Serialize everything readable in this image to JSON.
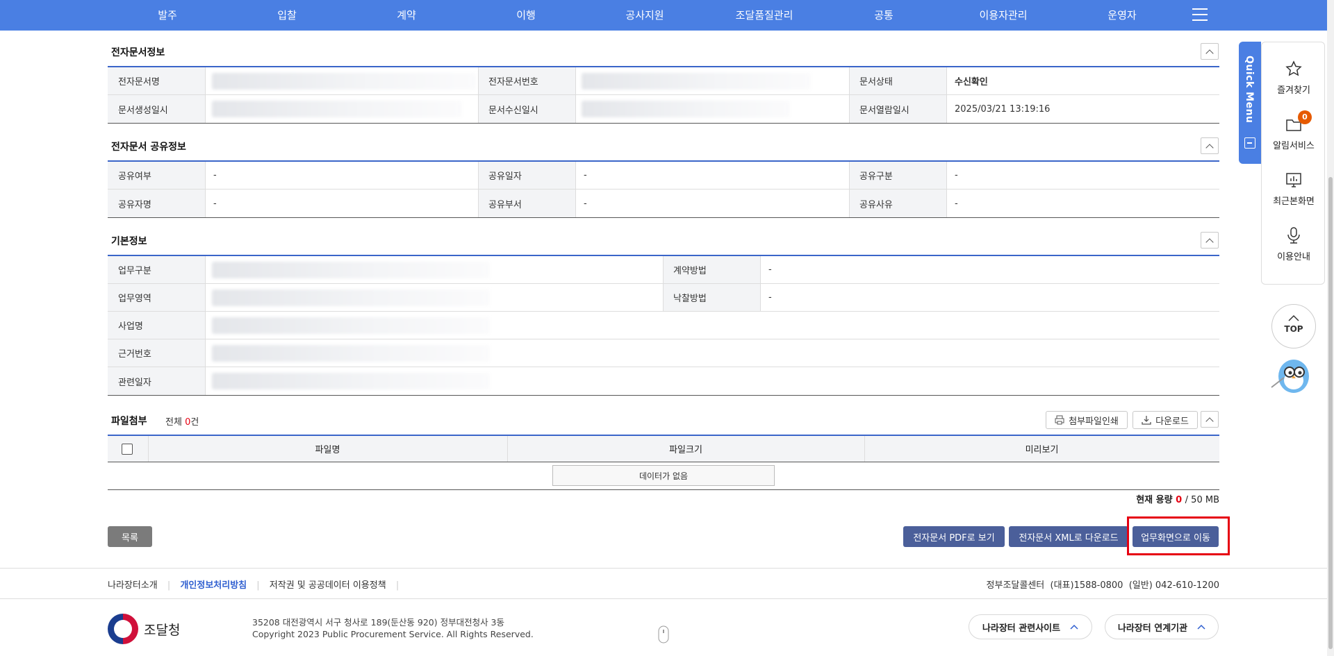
{
  "topnav": {
    "items": [
      "발주",
      "입찰",
      "계약",
      "이행",
      "공사지원",
      "조달품질관리",
      "공통",
      "이용자관리",
      "운영자"
    ]
  },
  "doc_info": {
    "title": "전자문서정보",
    "labels": {
      "name": "전자문서명",
      "number": "전자문서번호",
      "status": "문서상태",
      "created": "문서생성일시",
      "received": "문서수신일시",
      "opened": "문서열람일시"
    },
    "status_value": "수신확인",
    "opened_value": "2025/03/21 13:19:16"
  },
  "share_info": {
    "title": "전자문서 공유정보",
    "labels": {
      "shared": "공유여부",
      "share_date": "공유일자",
      "share_type": "공유구분",
      "sharer": "공유자명",
      "share_dept": "공유부서",
      "share_reason": "공유사유"
    },
    "values": {
      "shared": "-",
      "share_date": "-",
      "share_type": "-",
      "sharer": "-",
      "share_dept": "-",
      "share_reason": "-"
    }
  },
  "basic_info": {
    "title": "기본정보",
    "labels": {
      "biz_type": "업무구분",
      "contract_method": "계약방법",
      "biz_area": "업무영역",
      "award_method": "낙찰방법",
      "project": "사업명",
      "basis_no": "근거번호",
      "related_date": "관련일자"
    },
    "values": {
      "contract_method": "-",
      "award_method": "-"
    }
  },
  "attach": {
    "title": "파일첨부",
    "total_prefix": "전체",
    "total_count": "0",
    "total_suffix": "건",
    "print_label": "첨부파일인쇄",
    "download_label": "다운로드",
    "columns": [
      "파일명",
      "파일크기",
      "미리보기"
    ],
    "empty_text": "데이터가 없음",
    "usage_label": "현재 용량",
    "usage_value": "0",
    "usage_limit": "/ 50 MB"
  },
  "actions": {
    "list": "목록",
    "pdf": "전자문서 PDF로 보기",
    "xml": "전자문서 XML로 다운로드",
    "move": "업무화면으로 이동"
  },
  "footer": {
    "links": [
      "나라장터소개",
      "개인정보처리방침",
      "저작권 및 공공데이터 이용정책"
    ],
    "callcenter": "정부조달콜센터  (대표)1588-0800  (일반) 042-610-1200",
    "logo_text": "조달청",
    "address": "35208 대전광역시 서구 청사로 189(둔산동 920) 정부대전청사 3동",
    "copyright": "Copyright 2023 Public Procurement Service. All Rights Reserved.",
    "related_sites": "나라장터 관련사이트",
    "linked_orgs": "나라장터 연계기관"
  },
  "quick_menu": {
    "tab_label": "Quick Menu",
    "items": [
      "즐겨찾기",
      "알림서비스",
      "최근본화면",
      "이용안내"
    ],
    "badge": "0",
    "top_label": "TOP"
  },
  "colors": {
    "nav": "#4a7fe3",
    "table_border": "#3a65c9",
    "action_btn": "#4b5f9a",
    "highlight": "#e60012"
  }
}
